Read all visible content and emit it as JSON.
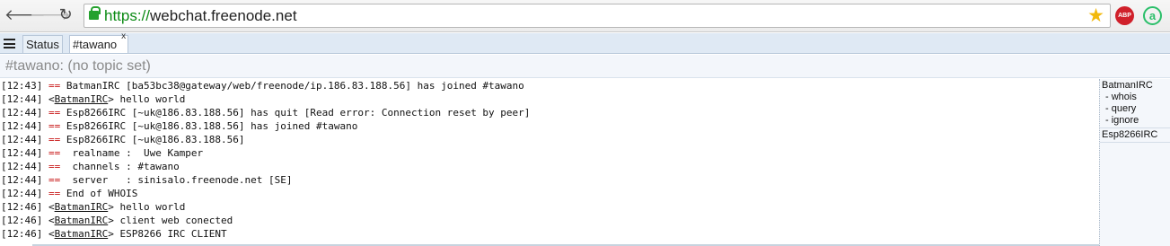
{
  "browser": {
    "url_scheme": "https://",
    "url_rest": "webchat.freenode.net",
    "back_glyph": "🡐",
    "forward_glyph": "🡒",
    "reload_glyph": "↻",
    "star_glyph": "★",
    "abp_label": "ABP",
    "ext_label": "a",
    "icons": [
      "back-icon",
      "forward-icon",
      "reload-icon",
      "lock-icon",
      "star-icon",
      "adblock-icon",
      "extension-icon"
    ],
    "colors": {
      "scheme_green": "#0b8a14",
      "star": "#f2b90d",
      "abp": "#d0202a",
      "ext": "#2bbf6a"
    }
  },
  "tabs": {
    "menu_icon": "hamburger-menu-icon",
    "items": [
      {
        "label": "Status"
      },
      {
        "label": "#tawano",
        "close": "x"
      }
    ]
  },
  "topic": "#tawano: (no topic set)",
  "log": [
    {
      "time": "[12:43]",
      "marker": "==",
      "text": " BatmanIRC [ba53bc38@gateway/web/freenode/ip.186.83.188.56] has joined #tawano"
    },
    {
      "time": "[12:44]",
      "nick": "BatmanIRC",
      "text": " hello world"
    },
    {
      "time": "[12:44]",
      "marker": "==",
      "text": " Esp8266IRC [~uk@186.83.188.56] has quit [Read error: Connection reset by peer]"
    },
    {
      "time": "[12:44]",
      "marker": "==",
      "text": " Esp8266IRC [~uk@186.83.188.56] has joined #tawano"
    },
    {
      "time": "[12:44]",
      "marker": "==",
      "text": " Esp8266IRC [~uk@186.83.188.56]"
    },
    {
      "time": "[12:44]",
      "marker": "==",
      "text": "  realname :  Uwe Kamper"
    },
    {
      "time": "[12:44]",
      "marker": "==",
      "text": "  channels : #tawano"
    },
    {
      "time": "[12:44]",
      "marker": "==",
      "text": "  server   : sinisalo.freenode.net [SE]"
    },
    {
      "time": "[12:44]",
      "marker": "==",
      "text": " End of WHOIS"
    },
    {
      "time": "[12:46]",
      "nick": "BatmanIRC",
      "text": " hello world"
    },
    {
      "time": "[12:46]",
      "nick": "BatmanIRC",
      "text": " client web conected"
    },
    {
      "time": "[12:46]",
      "nick": "BatmanIRC",
      "text": " ESP8266 IRC CLIENT"
    }
  ],
  "nicklist": [
    {
      "nick": "BatmanIRC",
      "actions": [
        "- whois",
        "- query",
        "- ignore"
      ]
    },
    {
      "nick": "Esp8266IRC",
      "actions": []
    }
  ],
  "colors": {
    "marker_red": "#c81414",
    "tabbar_bg": "#dfe9f4",
    "nicklist_bg": "#f4f7fb"
  }
}
